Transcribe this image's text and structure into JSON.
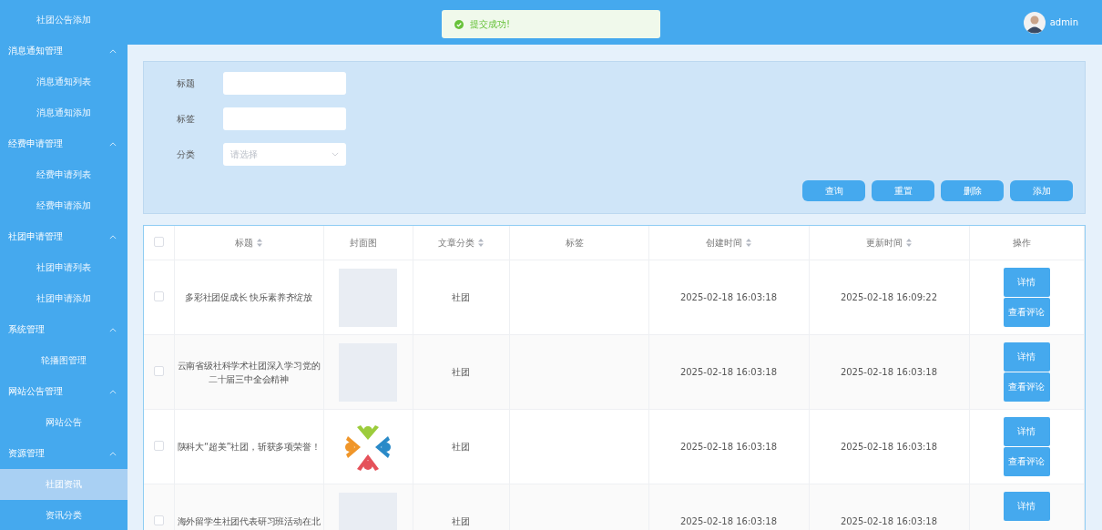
{
  "sidebar": {
    "items": [
      {
        "label": "社团公告添加",
        "selected": false
      },
      {
        "label": "消息通知管理",
        "expanded": true,
        "children": [
          {
            "label": "消息通知列表",
            "selected": false
          },
          {
            "label": "消息通知添加",
            "selected": false
          }
        ]
      },
      {
        "label": "经费申请管理",
        "expanded": true,
        "children": [
          {
            "label": "经费申请列表",
            "selected": false
          },
          {
            "label": "经费申请添加",
            "selected": false
          }
        ]
      },
      {
        "label": "社团申请管理",
        "expanded": true,
        "children": [
          {
            "label": "社团申请列表",
            "selected": false
          },
          {
            "label": "社团申请添加",
            "selected": false
          }
        ]
      },
      {
        "label": "系统管理",
        "expanded": true,
        "children": [
          {
            "label": "轮播图管理",
            "selected": false
          }
        ]
      },
      {
        "label": "网站公告管理",
        "expanded": true,
        "children": [
          {
            "label": "网站公告",
            "selected": false
          }
        ]
      },
      {
        "label": "资源管理",
        "expanded": true,
        "children": [
          {
            "label": "社团资讯",
            "selected": true
          },
          {
            "label": "资讯分类",
            "selected": false
          }
        ]
      }
    ]
  },
  "header": {
    "toast": {
      "kind": "success",
      "message": "提交成功!"
    },
    "user": {
      "name": "admin"
    }
  },
  "search": {
    "fields": [
      {
        "kind": "input",
        "label": "标题"
      },
      {
        "kind": "input",
        "label": "标签"
      },
      {
        "kind": "select",
        "label": "分类",
        "placeholder": "请选择"
      }
    ],
    "buttons": [
      "查询",
      "重置",
      "删除",
      "添加"
    ]
  },
  "table": {
    "select_all": {
      "checked": false
    },
    "columns": [
      {
        "label": "标题",
        "sortable": true
      },
      {
        "label": "封面图",
        "sortable": false
      },
      {
        "label": "文章分类",
        "sortable": true
      },
      {
        "label": "标签",
        "sortable": false
      },
      {
        "label": "创建时间",
        "sortable": true
      },
      {
        "label": "更新时间",
        "sortable": true
      },
      {
        "label": "操作",
        "sortable": false
      }
    ],
    "rows": [
      {
        "checked": false,
        "title": "多彩社团促成长 快乐素养齐绽放",
        "cover": {
          "kind": "empty"
        },
        "category": "社团",
        "created": "2025-02-18 16:03:18",
        "updated": "2025-02-18 16:09:22",
        "actions": [
          "详情",
          "查看评论"
        ]
      },
      {
        "checked": false,
        "title": "云南省级社科学术社团深入学习党的二十届三中全会精神",
        "cover": {
          "kind": "empty"
        },
        "category": "社团",
        "created": "2025-02-18 16:03:18",
        "updated": "2025-02-18 16:03:18",
        "actions": [
          "详情",
          "查看评论"
        ]
      },
      {
        "checked": false,
        "title": "陕科大“超美”社团，斩获多项荣誉！",
        "cover": {
          "kind": "picture"
        },
        "category": "社团",
        "created": "2025-02-18 16:03:18",
        "updated": "2025-02-18 16:03:18",
        "actions": [
          "详情",
          "查看评论"
        ]
      },
      {
        "checked": false,
        "title": "海外留学生社团代表研习班活动在北",
        "cover": {
          "kind": "empty"
        },
        "category": "社团",
        "created": "2025-02-18 16:03:18",
        "updated": "2025-02-18 16:03:18",
        "actions": [
          "详情"
        ]
      }
    ]
  }
}
